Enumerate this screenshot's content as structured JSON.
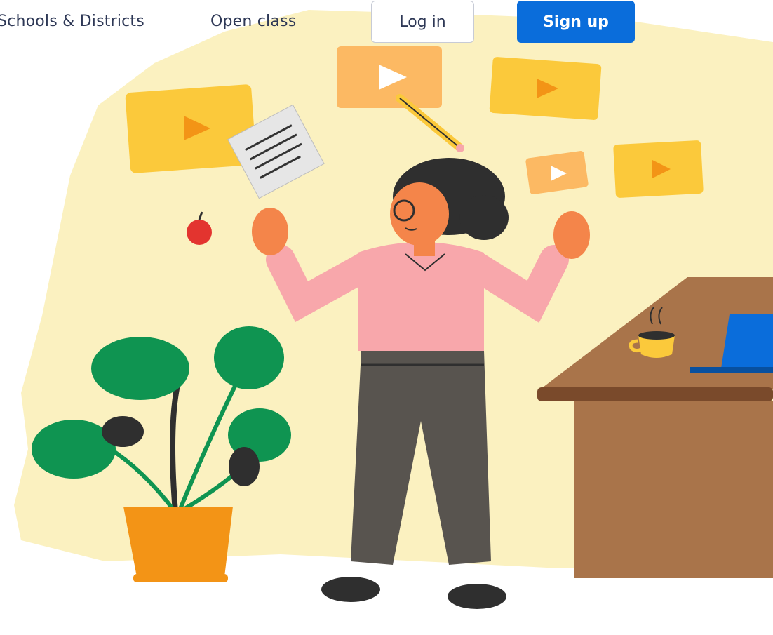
{
  "nav": {
    "schools_label": "Schools & Districts",
    "open_class_label": "Open class",
    "login_label": "Log in",
    "signup_label": "Sign up"
  },
  "colors": {
    "accent": "#0a6ddb",
    "backdrop": "#fbf1c0",
    "video_card": "#fbc93b",
    "video_card_light": "#fcb963",
    "shirt": "#f8a7ab",
    "pants": "#58544f",
    "hair": "#2f2f2f",
    "skin": "#f4854a",
    "plant": "#0f9451",
    "pot": "#f39416",
    "desk": "#a9744a",
    "laptop": "#0a6ddb"
  },
  "illustration": {
    "subject": "teacher-with-floating-videos",
    "icons": [
      "video-card-icon",
      "notes-icon",
      "pencil-icon",
      "apple-icon",
      "plant-icon",
      "coffee-icon",
      "laptop-icon"
    ]
  }
}
